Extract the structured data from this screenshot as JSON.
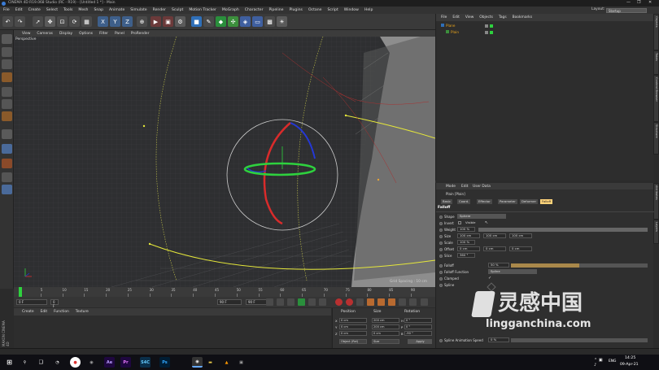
{
  "window": {
    "title": "CINEMA 4D R19.068 Studio (RC - R19) - [Untitled 1 *] - Main",
    "controls": [
      "—",
      "❐",
      "✕"
    ]
  },
  "menubar": [
    "File",
    "Edit",
    "Create",
    "Select",
    "Tools",
    "Mesh",
    "Snap",
    "Animate",
    "Simulate",
    "Render",
    "Sculpt",
    "Motion Tracker",
    "MoGraph",
    "Character",
    "Pipeline",
    "Plugins",
    "Octane",
    "Script",
    "Window",
    "Help"
  ],
  "layout": {
    "label": "Layout:",
    "value": "Startup"
  },
  "viewport": {
    "menu": [
      "View",
      "Cameras",
      "Display",
      "Options",
      "Filter",
      "Panel",
      "ProRender"
    ],
    "name": "Perspective",
    "grid_spacing": "Grid Spacing : 10 cm"
  },
  "timeline": {
    "ticks": [
      "0",
      "5",
      "10",
      "15",
      "20",
      "25",
      "30",
      "35",
      "40",
      "45",
      "50",
      "55",
      "60",
      "65",
      "70",
      "75",
      "80",
      "85",
      "90"
    ],
    "current_frame": "0 F",
    "start": "0 F",
    "end": "90 F",
    "end2": "90 F"
  },
  "material_manager": {
    "menu": [
      "Create",
      "Edit",
      "Function",
      "Texture"
    ]
  },
  "coordinates": {
    "headers": [
      "Position",
      "Size",
      "Rotation"
    ],
    "rows": [
      {
        "axis": "X",
        "pos": "0 cm",
        "size": "200 cm",
        "rot_label": "H",
        "rot": "0 °"
      },
      {
        "axis": "Y",
        "pos": "0 cm",
        "size": "200 cm",
        "rot_label": "P",
        "rot": "0 °"
      },
      {
        "axis": "Z",
        "pos": "0 cm",
        "size": "0 cm",
        "rot_label": "B",
        "rot": "-90 °"
      }
    ],
    "mode": "Object (Rel)",
    "size_mode": "Size",
    "apply": "Apply"
  },
  "object_manager": {
    "menu": [
      "File",
      "Edit",
      "View",
      "Objects",
      "Tags",
      "Bookmarks"
    ],
    "objects": [
      "Plane",
      "Plain"
    ]
  },
  "attributes": {
    "menu": [
      "Mode",
      "Edit",
      "User Data"
    ],
    "object_title": "Plain [Plain]",
    "tabs": [
      "Basic",
      "Coord.",
      "Effector",
      "Parameter",
      "Deformer",
      "Falloff"
    ],
    "active_tab": "Falloff",
    "section": "Falloff",
    "rows": [
      {
        "label": "Shape",
        "value": "Sphere"
      },
      {
        "label": "Invert",
        "value": "Visible"
      },
      {
        "label": "Weight",
        "value": "100 %"
      },
      {
        "label": "Size",
        "x": "100 cm",
        "y": "100 cm",
        "z": "100 cm"
      },
      {
        "label": "Scale",
        "value": "100 %"
      },
      {
        "label": "Offset",
        "x": "0 cm",
        "y": "0 cm",
        "z": "0 cm"
      },
      {
        "label": "Slice",
        "value": "360 °"
      }
    ],
    "falloff": {
      "label": "Falloff",
      "value": "50 %",
      "level": 0.5
    },
    "falloff_function": {
      "label": "Falloff Function",
      "value": "Spline"
    },
    "clamped": "Clamped",
    "spline": "Spline",
    "spline_anim": {
      "label": "Spline Animation Speed",
      "value": "0 %"
    }
  },
  "side_tabs": [
    "Objects",
    "Takes",
    "Content Browser",
    "Structure",
    "Attributes",
    "Layers"
  ],
  "watermark": {
    "text": "灵感中国",
    "url": "lingganchina.com"
  },
  "brand": "MAXON CINEMA 4D",
  "taskbar": {
    "apps": [
      "Ae",
      "Pr",
      "S4C",
      "Ps"
    ],
    "lang": "ENG",
    "time": "14:25",
    "date": "09-Apr-21"
  },
  "colors": {
    "accent_orange": "#e8a31b",
    "axis_red": "#d92b2b",
    "axis_green": "#2ed13e",
    "axis_blue": "#2438d6",
    "spline_yellow": "#e6e83a",
    "active_tab": "#ffd37a"
  }
}
